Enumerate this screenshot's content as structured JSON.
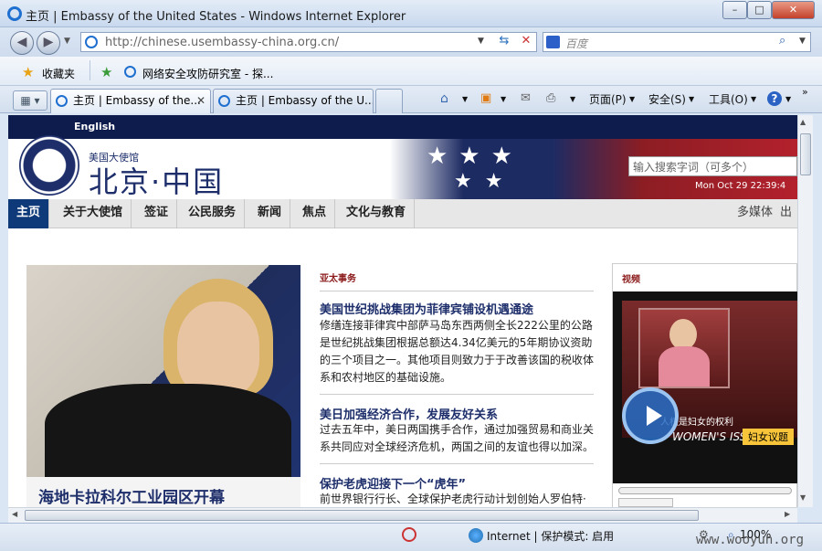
{
  "window": {
    "title": "主页 | Embassy of the United States - Windows Internet Explorer"
  },
  "nav": {
    "address": "http://chinese.usembassy-china.org.cn/",
    "search_placeholder": "百度"
  },
  "favorites": {
    "label": "收藏夹",
    "items": [
      "网络安全攻防研究室 - 探..."
    ]
  },
  "tabs": [
    "主页 | Embassy of the...",
    "主页 | Embassy of the U..."
  ],
  "commands": {
    "page": "页面(P)",
    "safety": "安全(S)",
    "tools": "工具(O)"
  },
  "site": {
    "english_link": "English",
    "embassy_small": "美国大使馆",
    "embassy_big": "北京·中国",
    "search_placeholder": "输入搜索字词（可多个）",
    "date": "Mon Oct 29 22:39:4",
    "nav_items": [
      "主页",
      "关于大使馆",
      "签证",
      "公民服务",
      "新闻",
      "焦点",
      "文化与教育"
    ],
    "nav_right": [
      "多媒体",
      "出"
    ],
    "feature_caption": "海地卡拉科尔工业园区开幕",
    "section_label": "亚太事务",
    "articles": [
      {
        "title": "美国世纪挑战集团为菲律宾铺设机遇通途",
        "lines": [
          "修缮连接菲律宾中部萨马岛东西两侧全长222公里的公路",
          "是世纪挑战集团根据总额达4.34亿美元的5年期协议资助",
          "的三个项目之一。其他项目则致力于于改善该国的税收体",
          "系和农村地区的基础设施。"
        ]
      },
      {
        "title": "美日加强经济合作，发展友好关系",
        "lines": [
          "过去五年中，美日两国携手合作，通过加强贸易和商业关",
          "系共同应对全球经济危机，两国之间的友谊也得以加深。"
        ]
      },
      {
        "title": "保护老虎迎接下一个“虎年”",
        "lines": [
          "前世界银行行长、全球保护老虎行动计划创始人罗伯特·"
        ]
      }
    ],
    "video": {
      "label": "视频",
      "caption": "人权是妇女的权利",
      "women": "WOMEN'S ISSUES",
      "tag": "妇女议题"
    }
  },
  "status": {
    "zone": "Internet | 保护模式: 启用",
    "zoom": "100%"
  },
  "watermark": "www.wooyun.org"
}
